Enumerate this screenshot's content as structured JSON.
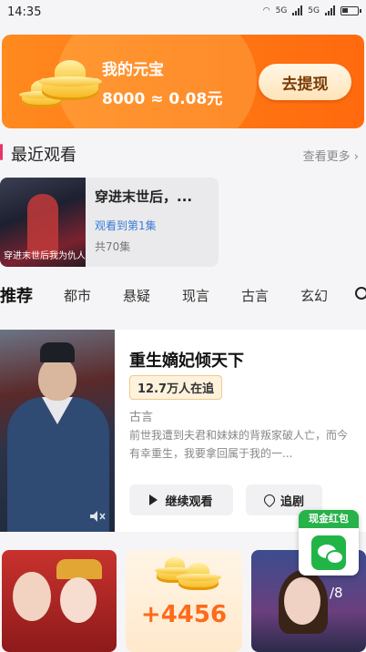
{
  "status_bar": {
    "time": "14:35",
    "signal1": "5G",
    "signal2": "5G"
  },
  "ingot_card": {
    "title": "我的元宝",
    "value": "8000 ≈ 0.08元",
    "withdraw_button": "去提现"
  },
  "recent": {
    "section_title": "最近观看",
    "more_label": "查看更多",
    "item": {
      "title": "穿进末世后，...",
      "episode": "观看到第1集",
      "count": "共70集",
      "poster_text": "穿进末世后我为仇人"
    }
  },
  "tabs": [
    "推荐",
    "都市",
    "悬疑",
    "现言",
    "古言",
    "玄幻"
  ],
  "featured": {
    "title": "重生嫡妃倾天下",
    "followers": "12.7万人在追",
    "genre": "古言",
    "description": "前世我遭到夫君和妹妹的背叛家破人亡，而今有幸重生，我要拿回属于我的一...",
    "watch_button": "继续观看",
    "follow_button": "追剧"
  },
  "bottom_row": {
    "reward_value": "+4456",
    "thumb3_number": "/8"
  },
  "red_packet": {
    "label": "现金红包"
  },
  "colors": {
    "accent_orange": "#ff7a14",
    "accent_pink": "#e8346b",
    "link_blue": "#3a7bd5",
    "wechat_green": "#21b548"
  }
}
